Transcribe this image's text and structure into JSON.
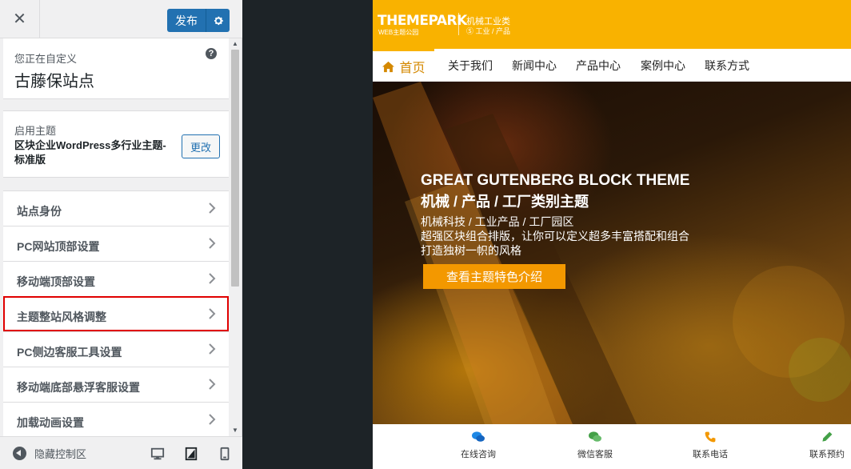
{
  "customizer": {
    "close_label": "✕",
    "publish_label": "发布",
    "info_small": "您正在自定义",
    "site_title": "古藤保站点",
    "help_label": "?",
    "theme_label": "启用主题",
    "theme_name": "区块企业WordPress多行业主题-标准版",
    "change_label": "更改",
    "menu": [
      {
        "label": "站点身份"
      },
      {
        "label": "PC网站顶部设置"
      },
      {
        "label": "移动端顶部设置"
      },
      {
        "label": "主题整站风格调整"
      },
      {
        "label": "PC侧边客服工具设置"
      },
      {
        "label": "移动端底部悬浮客服设置"
      },
      {
        "label": "加载动画设置"
      }
    ],
    "active_menu_index": 3,
    "collapse_label": "隐藏控制区",
    "active_device": "tablet"
  },
  "preview": {
    "logo": {
      "text": "THEMEPARK",
      "sub": "WEB主题公园",
      "cat1": "机械工业类",
      "cat2": "Ⓢ 工业 / 产品"
    },
    "nav": {
      "home": "首页",
      "links": [
        "关于我们",
        "新闻中心",
        "产品中心",
        "案例中心",
        "联系方式"
      ]
    },
    "hero": {
      "line1": "GREAT GUTENBERG BLOCK THEME",
      "line2": "机械 / 产品 / 工厂类别主题",
      "line3": "机械科技 / 工业产品 / 工厂园区",
      "line4": "超强区块组合排版，让你可以定义超多丰富搭配和组合",
      "line5": "打造独树一帜的风格",
      "button": "查看主题特色介绍"
    },
    "bottom_bar": [
      "在线咨询",
      "微信客服",
      "联系电话",
      "联系预约"
    ]
  },
  "colors": {
    "publish": "#2271b1",
    "brand": "#f9b200",
    "cta": "#f39800",
    "highlight_border": "#e00000"
  }
}
